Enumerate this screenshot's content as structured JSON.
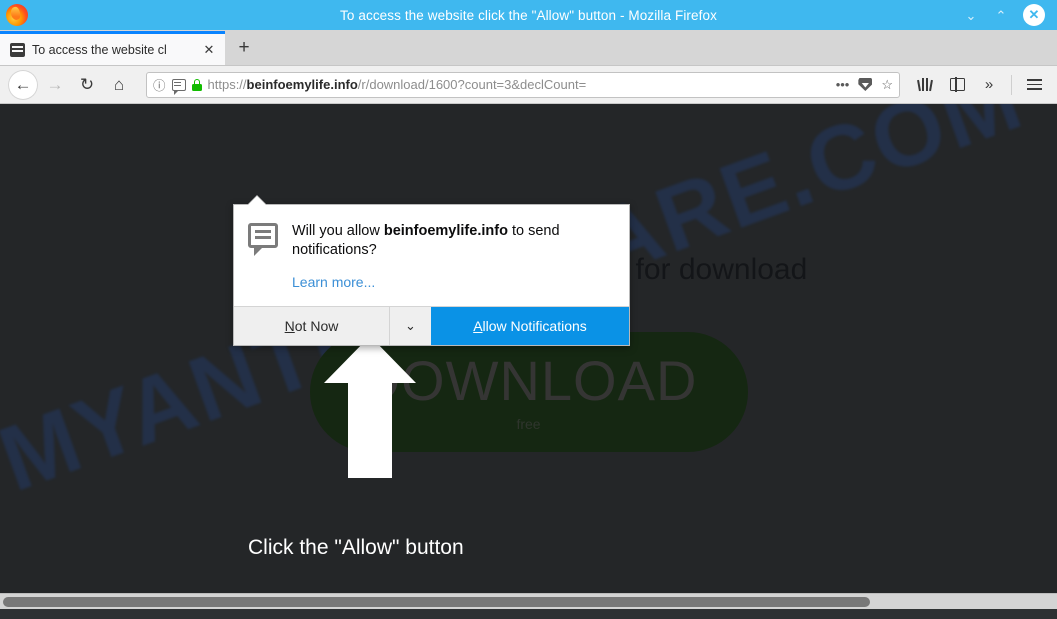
{
  "window": {
    "title": "To access the website click the \"Allow\" button - Mozilla Firefox",
    "minimize_label": "⌄",
    "maximize_label": "⌃",
    "close_label": "✕",
    "logo_icon": "firefox-logo-icon"
  },
  "tabs": {
    "items": [
      {
        "title": "To access the website cl",
        "favicon": "page-favicon",
        "close_label": "✕"
      }
    ],
    "new_tab_label": "+"
  },
  "toolbar": {
    "back_label": "←",
    "forward_label": "→",
    "reload_label": "↻",
    "home_label": "⌂",
    "library_icon": "library-icon",
    "sidebar_icon": "sidebar-icon",
    "overflow_label": "»",
    "menu_icon": "hamburger-menu-icon"
  },
  "urlbar": {
    "identity_icon": "ⓘ",
    "permission_icon": "notification-permission-icon",
    "lock_icon": "lock-icon",
    "url_scheme": "https://",
    "url_host": "beinfoemylife.info",
    "url_path": "/r/download/1600?count=3&declCount=",
    "page_actions_label": "•••",
    "pocket_icon": "pocket-icon",
    "bookmark_label": "☆"
  },
  "doorhanger": {
    "icon": "notification-bubble-icon",
    "question_prefix": "Will you allow ",
    "question_host": "beinfoemylife.info",
    "question_suffix": " to send notifications?",
    "learn_more": "Learn more...",
    "not_now_first": "N",
    "not_now_rest": "ot Now",
    "dropdown_label": "⌄",
    "allow_first": "A",
    "allow_rest": "llow Notifications"
  },
  "page": {
    "heading": "Your file File291234 is ready for download",
    "download_label": "DOWNLOAD",
    "download_sub": "free",
    "watermark": "MYANTISPYWARE.COM",
    "annotation_caption": "Click the \"Allow\" button",
    "annotation_arrow": "up-arrow-annotation"
  },
  "scrollbar": {
    "thumb": "horizontal-scroll-thumb"
  },
  "colors": {
    "titlebar": "#3fb8ef",
    "accent_blue": "#0a92e6",
    "link_blue": "#3b8fd6",
    "page_background": "#2e3133",
    "download_green": "#16330f",
    "lock_green": "#12bc00",
    "watermark_blue": "#2b4b86"
  }
}
